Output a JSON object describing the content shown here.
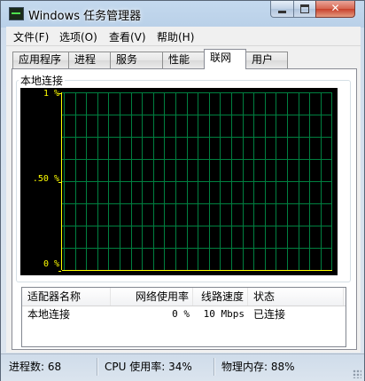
{
  "window": {
    "title": "Windows 任务管理器",
    "min_symbol": "",
    "max_symbol": "",
    "close_symbol": "✕"
  },
  "menu": [
    "文件(F)",
    "选项(O)",
    "查看(V)",
    "帮助(H)"
  ],
  "tabs": [
    {
      "label": "应用程序",
      "active": false
    },
    {
      "label": "进程",
      "active": false
    },
    {
      "label": "服务",
      "active": false
    },
    {
      "label": "性能",
      "active": false
    },
    {
      "label": "联网",
      "active": true
    },
    {
      "label": "用户",
      "active": false
    }
  ],
  "network_graph": {
    "group_label": "本地连接",
    "y_labels": {
      "top": "1 %",
      "mid": ".50 %",
      "bottom": "0 %"
    },
    "colors": {
      "background": "#000000",
      "grid": "#008040",
      "axis": "#ffff00",
      "line": "#ffff00"
    },
    "utilization_percent": 0
  },
  "adapters": {
    "columns": [
      "适配器名称",
      "网络使用率",
      "线路速度",
      "状态"
    ],
    "rows": [
      {
        "name": "本地连接",
        "usage": "0 %",
        "speed": "10 Mbps",
        "state": "已连接"
      }
    ]
  },
  "status": {
    "processes": "进程数: 68",
    "cpu": "CPU 使用率: 34%",
    "memory": "物理内存: 88%"
  }
}
